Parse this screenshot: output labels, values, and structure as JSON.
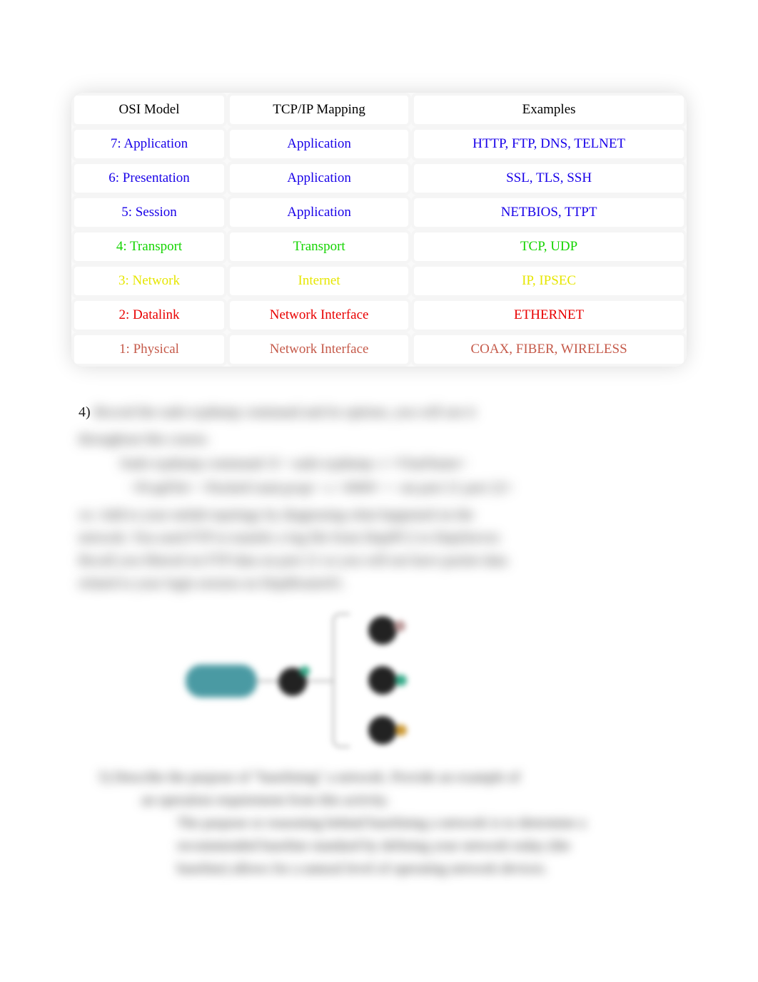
{
  "table": {
    "headers": [
      "OSI Model",
      "TCP/IP Mapping",
      "Examples"
    ],
    "rows": [
      {
        "cells": [
          "7: Application",
          "Application",
          "HTTP, FTP, DNS, TELNET"
        ],
        "color": "c-blue"
      },
      {
        "cells": [
          "6: Presentation",
          "Application",
          "SSL, TLS, SSH"
        ],
        "color": "c-blue"
      },
      {
        "cells": [
          "5: Session",
          "Application",
          "NETBIOS, TTPT"
        ],
        "color": "c-blue"
      },
      {
        "cells": [
          "4: Transport",
          "Transport",
          "TCP, UDP"
        ],
        "color": "c-green"
      },
      {
        "cells": [
          "3: Network",
          "Internet",
          "IP, IPSEC"
        ],
        "color": "c-yellow"
      },
      {
        "cells": [
          "2: Datalink",
          "Network Interface",
          "ETHERNET"
        ],
        "color": "c-red"
      },
      {
        "cells": [
          "1: Physical",
          "Network Interface",
          "COAX, FIBER, WIRELESS"
        ],
        "color": "c-brick"
      }
    ]
  },
  "q4": {
    "num": "4)",
    "line1": "Record the  sudo  tcpdump    command and its options, you will use it",
    "line2": "throughout this course.",
    "bul_a": "Sudo tcpdump command: $ >  sudo tcpdump  -i <VlanName>",
    "bul_b": "<PcapFile> <PacketCount.pcap>  -c  <####>  <  -nn port 21 port 22>",
    "p1": "xx: Add to your netlab topology by diagnosing what happened on the",
    "p2": "network. You used FTP to transfer a log file from DeptPC2  to DeptServer.",
    "p3": "Recall you filtered on FTP data    on port 21        so you will not have packet data",
    "p4": "related to your login session on DeptRouter01."
  },
  "q5": {
    "line1": "5) Describe the purpose of \"baselining\" a network. Provide an example of",
    "line2": "an operation requirement from this activity.",
    "sub1": "The purpose or reasoning behind baselining a network is to determine a",
    "sub2": "recommended baseline standard by  defining your network today (the",
    "sub3": "baseline) allows for a natural level of operating network devices."
  }
}
